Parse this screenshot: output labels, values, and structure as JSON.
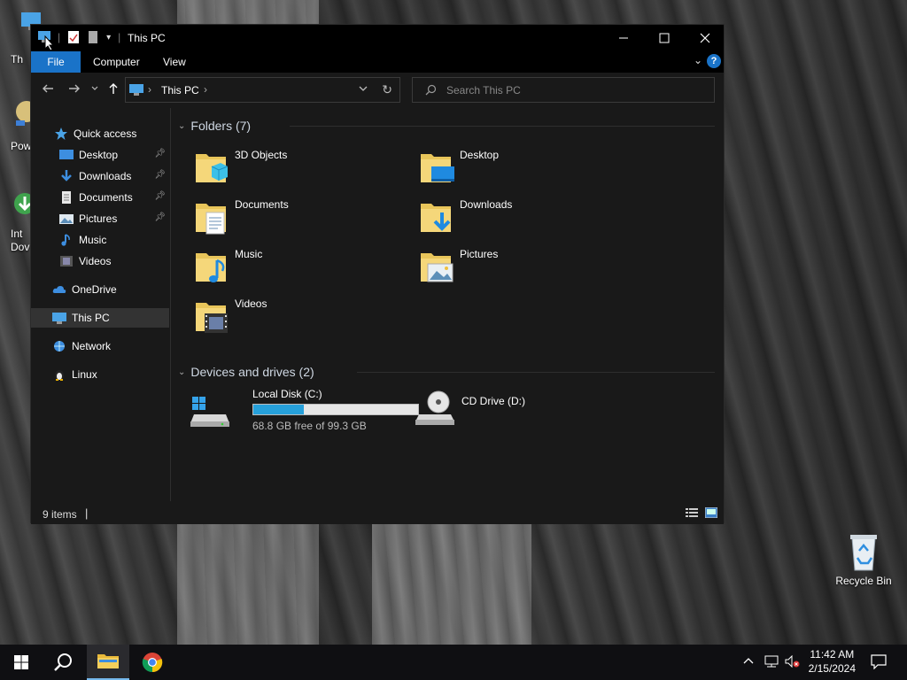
{
  "desktop": {
    "icons_partial": [
      {
        "label": "Th"
      },
      {
        "label": "Pow"
      },
      {
        "label": "Int"
      },
      {
        "label": "Dov"
      }
    ],
    "recycle_bin": {
      "label": "Recycle Bin"
    }
  },
  "window": {
    "title": "This PC",
    "ribbon_tabs": [
      "File",
      "Computer",
      "View"
    ],
    "help_label": "?",
    "address": {
      "location": "This PC"
    },
    "search": {
      "placeholder": "Search This PC"
    },
    "sidebar": {
      "quick_access": "Quick access",
      "pinned": [
        {
          "label": "Desktop",
          "icon": "desktop-folder-icon"
        },
        {
          "label": "Downloads",
          "icon": "downloads-folder-icon"
        },
        {
          "label": "Documents",
          "icon": "documents-folder-icon"
        },
        {
          "label": "Pictures",
          "icon": "pictures-folder-icon"
        }
      ],
      "unpinned": [
        {
          "label": "Music",
          "icon": "music-folder-icon"
        },
        {
          "label": "Videos",
          "icon": "videos-folder-icon"
        }
      ],
      "onedrive": "OneDrive",
      "this_pc": "This PC",
      "network": "Network",
      "linux": "Linux"
    },
    "folders_header": "Folders (7)",
    "folders": [
      {
        "label": "3D Objects",
        "icon": "3d-objects-folder-icon"
      },
      {
        "label": "Desktop",
        "icon": "desktop-folder-icon"
      },
      {
        "label": "Documents",
        "icon": "documents-folder-icon"
      },
      {
        "label": "Downloads",
        "icon": "downloads-folder-icon"
      },
      {
        "label": "Music",
        "icon": "music-folder-icon"
      },
      {
        "label": "Pictures",
        "icon": "pictures-folder-icon"
      },
      {
        "label": "Videos",
        "icon": "videos-folder-icon"
      }
    ],
    "drives_header": "Devices and drives (2)",
    "drives": [
      {
        "label": "Local Disk (C:)",
        "free_text": "68.8 GB free of 99.3 GB",
        "used_fraction": 0.307
      },
      {
        "label": "CD Drive (D:)"
      }
    ],
    "status": {
      "items": "9 items"
    }
  },
  "taskbar": {
    "clock_time": "11:42 AM",
    "clock_date": "2/15/2024"
  },
  "colors": {
    "accent": "#1a73c8",
    "drive_fill": "#26a0da",
    "window_bg": "#191919"
  }
}
